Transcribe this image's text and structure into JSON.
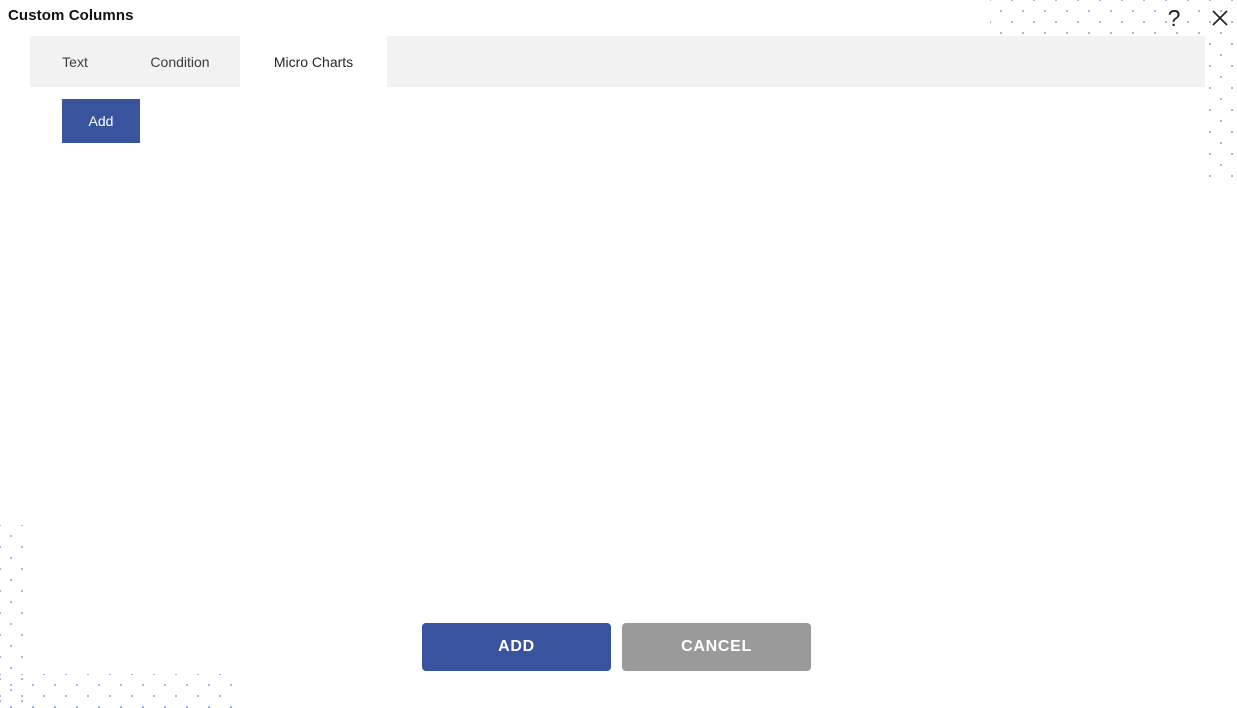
{
  "dialog": {
    "title": "Custom Columns",
    "help_icon": "question-mark-icon",
    "close_icon": "close-x-icon"
  },
  "tabs": [
    {
      "id": "text",
      "label": "Text",
      "selected": false
    },
    {
      "id": "condition",
      "label": "Condition",
      "selected": false
    },
    {
      "id": "micro-charts",
      "label": "Micro Charts",
      "selected": true
    }
  ],
  "panel": {
    "add_button_label": "Add"
  },
  "footer": {
    "confirm_label": "ADD",
    "cancel_label": "CANCEL"
  },
  "colors": {
    "accent_blue": "#39539F",
    "cancel_gray": "#9A9A9A",
    "tabbar_gray": "#F2F2F2",
    "dot_pattern": "#AAB4E0"
  }
}
